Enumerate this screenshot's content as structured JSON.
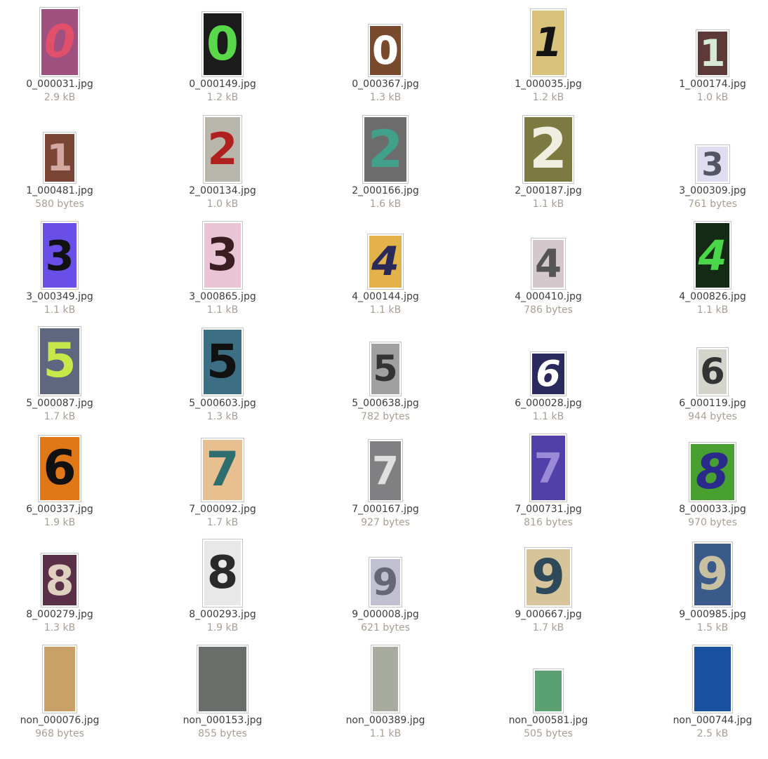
{
  "files": [
    {
      "name": "0_000031.jpg",
      "size": "2.9 kB",
      "glyph": "0",
      "bg": "#a0507e",
      "fg": "#e0506a",
      "italic": true
    },
    {
      "name": "0_000149.jpg",
      "size": "1.2 kB",
      "glyph": "0",
      "bg": "#1c1c1c",
      "fg": "#59d94a",
      "italic": false
    },
    {
      "name": "0_000367.jpg",
      "size": "1.3 kB",
      "glyph": "0",
      "bg": "#7a4a2e",
      "fg": "#ffffff",
      "italic": false
    },
    {
      "name": "1_000035.jpg",
      "size": "1.2 kB",
      "glyph": "1",
      "bg": "#d8c27a",
      "fg": "#141414",
      "italic": true
    },
    {
      "name": "1_000174.jpg",
      "size": "1.0 kB",
      "glyph": "1",
      "bg": "#5c3a38",
      "fg": "#d8ead6",
      "italic": false
    },
    {
      "name": "1_000481.jpg",
      "size": "580 bytes",
      "glyph": "1",
      "bg": "#7a4535",
      "fg": "#d2a8a0",
      "italic": false
    },
    {
      "name": "2_000134.jpg",
      "size": "1.0 kB",
      "glyph": "2",
      "bg": "#b9b6ab",
      "fg": "#b0201e",
      "italic": false
    },
    {
      "name": "2_000166.jpg",
      "size": "1.6 kB",
      "glyph": "2",
      "bg": "#6c6c6c",
      "fg": "#40a08a",
      "italic": false
    },
    {
      "name": "2_000187.jpg",
      "size": "1.1 kB",
      "glyph": "2",
      "bg": "#7c7a40",
      "fg": "#f0eee0",
      "italic": false
    },
    {
      "name": "3_000309.jpg",
      "size": "761 bytes",
      "glyph": "3",
      "bg": "#dedef0",
      "fg": "#555566",
      "italic": false
    },
    {
      "name": "3_000349.jpg",
      "size": "1.1 kB",
      "glyph": "3",
      "bg": "#6a4ee8",
      "fg": "#111111",
      "italic": false
    },
    {
      "name": "3_000865.jpg",
      "size": "1.1 kB",
      "glyph": "3",
      "bg": "#e8c4d4",
      "fg": "#3a1e22",
      "italic": false
    },
    {
      "name": "4_000144.jpg",
      "size": "1.1 kB",
      "glyph": "4",
      "bg": "#e4b24a",
      "fg": "#2a2a5a",
      "italic": true
    },
    {
      "name": "4_000410.jpg",
      "size": "786 bytes",
      "glyph": "4",
      "bg": "#d4c8cc",
      "fg": "#555555",
      "italic": false
    },
    {
      "name": "4_000826.jpg",
      "size": "1.1 kB",
      "glyph": "4",
      "bg": "#142a14",
      "fg": "#4ad84a",
      "italic": true
    },
    {
      "name": "5_000087.jpg",
      "size": "1.7 kB",
      "glyph": "5",
      "bg": "#5e6680",
      "fg": "#c8e84a",
      "italic": false
    },
    {
      "name": "5_000603.jpg",
      "size": "1.3 kB",
      "glyph": "5",
      "bg": "#3c6e84",
      "fg": "#111111",
      "italic": false
    },
    {
      "name": "5_000638.jpg",
      "size": "782 bytes",
      "glyph": "5",
      "bg": "#a0a0a0",
      "fg": "#333333",
      "italic": false
    },
    {
      "name": "6_000028.jpg",
      "size": "1.1 kB",
      "glyph": "6",
      "bg": "#2a2a5e",
      "fg": "#ffffff",
      "italic": true
    },
    {
      "name": "6_000119.jpg",
      "size": "944 bytes",
      "glyph": "6",
      "bg": "#d4d4cc",
      "fg": "#333333",
      "italic": false
    },
    {
      "name": "6_000337.jpg",
      "size": "1.9 kB",
      "glyph": "6",
      "bg": "#e07818",
      "fg": "#111111",
      "italic": false
    },
    {
      "name": "7_000092.jpg",
      "size": "1.7 kB",
      "glyph": "7",
      "bg": "#e8c090",
      "fg": "#2e6e6e",
      "italic": false
    },
    {
      "name": "7_000167.jpg",
      "size": "927 bytes",
      "glyph": "7",
      "bg": "#808082",
      "fg": "#e0e0e0",
      "italic": false
    },
    {
      "name": "7_000731.jpg",
      "size": "816 bytes",
      "glyph": "7",
      "bg": "#5040a8",
      "fg": "#9a8ad8",
      "italic": false
    },
    {
      "name": "8_000033.jpg",
      "size": "970 bytes",
      "glyph": "8",
      "bg": "#48a030",
      "fg": "#2a2a8a",
      "italic": true
    },
    {
      "name": "8_000279.jpg",
      "size": "1.3 kB",
      "glyph": "8",
      "bg": "#5a3048",
      "fg": "#e0d0c0",
      "italic": false
    },
    {
      "name": "8_000293.jpg",
      "size": "1.9 kB",
      "glyph": "8",
      "bg": "#e8e8e8",
      "fg": "#2a2a2a",
      "italic": false
    },
    {
      "name": "9_000008.jpg",
      "size": "621 bytes",
      "glyph": "9",
      "bg": "#c0c0d0",
      "fg": "#666677",
      "italic": false
    },
    {
      "name": "9_000667.jpg",
      "size": "1.7 kB",
      "glyph": "9",
      "bg": "#d8c49a",
      "fg": "#2e4a5a",
      "italic": false
    },
    {
      "name": "9_000985.jpg",
      "size": "1.5 kB",
      "glyph": "9",
      "bg": "#3a5a8a",
      "fg": "#c8c0a0",
      "italic": false
    },
    {
      "name": "non_000076.jpg",
      "size": "968 bytes",
      "glyph": "",
      "bg": "#c8a068",
      "fg": "#000000",
      "italic": false
    },
    {
      "name": "non_000153.jpg",
      "size": "855 bytes",
      "glyph": "",
      "bg": "#6a6e6a",
      "fg": "#000000",
      "italic": false
    },
    {
      "name": "non_000389.jpg",
      "size": "1.1 kB",
      "glyph": "",
      "bg": "#a8aca0",
      "fg": "#000000",
      "italic": false
    },
    {
      "name": "non_000581.jpg",
      "size": "505 bytes",
      "glyph": "",
      "bg": "#5aa070",
      "fg": "#000000",
      "italic": false
    },
    {
      "name": "non_000744.jpg",
      "size": "2.5 kB",
      "glyph": "",
      "bg": "#1a50a0",
      "fg": "#000000",
      "italic": false
    }
  ]
}
